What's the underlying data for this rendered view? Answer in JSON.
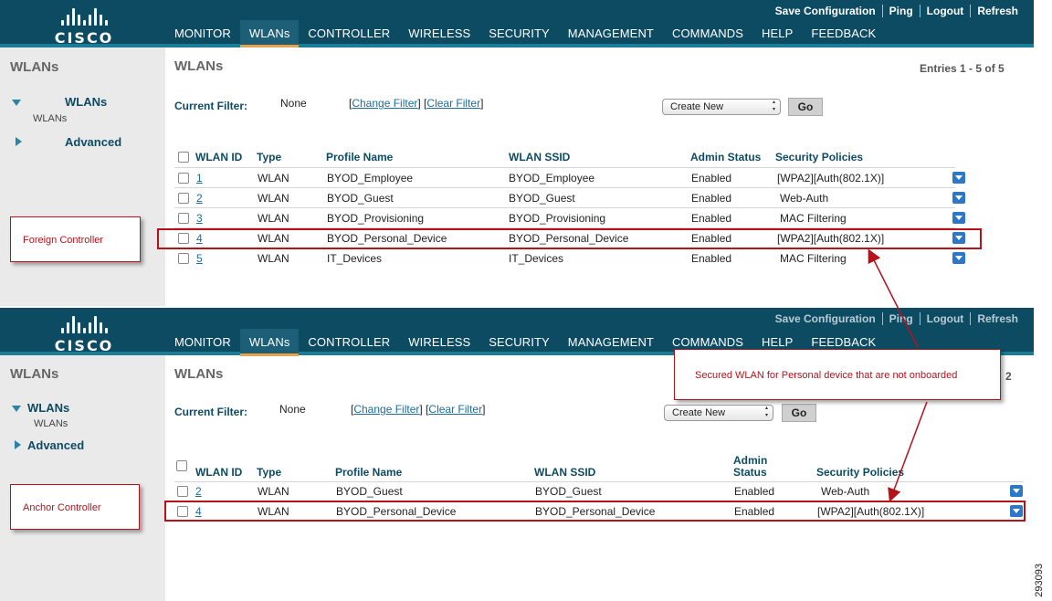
{
  "brand": {
    "name": "CISCO"
  },
  "top_links": [
    "Save Configuration",
    "Ping",
    "Logout",
    "Refresh"
  ],
  "menu": [
    "MONITOR",
    "WLANs",
    "CONTROLLER",
    "WIRELESS",
    "SECURITY",
    "MANAGEMENT",
    "COMMANDS",
    "HELP",
    "FEEDBACK"
  ],
  "active_menu": "WLANs",
  "colors": {
    "header": "#0d4b63",
    "accent": "#e8a24c",
    "callout": "#b5121b",
    "link": "#1d6d9a"
  },
  "foreign": {
    "sidebar": {
      "title": "WLANs",
      "wlans": "WLANs",
      "wlans_sub": "WLANs",
      "advanced": "Advanced"
    },
    "title": "WLANs",
    "entries": "Entries 1 - 5 of 5",
    "filter": {
      "label": "Current Filter:",
      "value": "None",
      "change": "Change Filter",
      "clear": "Clear Filter"
    },
    "create_new": "Create New",
    "go": "Go",
    "columns": [
      "WLAN ID",
      "Type",
      "Profile Name",
      "WLAN SSID",
      "Admin Status",
      "Security Policies"
    ],
    "rows": [
      {
        "id": "1",
        "type": "WLAN",
        "profile": "BYOD_Employee",
        "ssid": "BYOD_Employee",
        "status": "Enabled",
        "security": "[WPA2][Auth(802.1X)]"
      },
      {
        "id": "2",
        "type": "WLAN",
        "profile": "BYOD_Guest",
        "ssid": "BYOD_Guest",
        "status": "Enabled",
        "security": "Web-Auth"
      },
      {
        "id": "3",
        "type": "WLAN",
        "profile": "BYOD_Provisioning",
        "ssid": "BYOD_Provisioning",
        "status": "Enabled",
        "security": "MAC Filtering"
      },
      {
        "id": "4",
        "type": "WLAN",
        "profile": "BYOD_Personal_Device",
        "ssid": "BYOD_Personal_Device",
        "status": "Enabled",
        "security": "[WPA2][Auth(802.1X)]"
      },
      {
        "id": "5",
        "type": "WLAN",
        "profile": "IT_Devices",
        "ssid": "IT_Devices",
        "status": "Enabled",
        "security": "MAC Filtering"
      }
    ]
  },
  "anchor": {
    "sidebar": {
      "title": "WLANs",
      "wlans": "WLANs",
      "wlans_sub": "WLANs",
      "advanced": "Advanced"
    },
    "title": "WLANs",
    "entries_tail": "2",
    "filter": {
      "label": "Current Filter:",
      "value": "None",
      "change": "Change Filter",
      "clear": "Clear Filter"
    },
    "create_new": "Create New",
    "go": "Go",
    "columns": [
      "WLAN ID",
      "Type",
      "Profile Name",
      "WLAN SSID",
      "Admin Status",
      "Security Policies"
    ],
    "admin_status_line1": "Admin",
    "admin_status_line2": "Status",
    "rows": [
      {
        "id": "2",
        "type": "WLAN",
        "profile": "BYOD_Guest",
        "ssid": "BYOD_Guest",
        "status": "Enabled",
        "security": "Web-Auth"
      },
      {
        "id": "4",
        "type": "WLAN",
        "profile": "BYOD_Personal_Device",
        "ssid": "BYOD_Personal_Device",
        "status": "Enabled",
        "security": "[WPA2][Auth(802.1X)]"
      }
    ]
  },
  "annotations": {
    "foreign_label": "Foreign Controller",
    "anchor_label": "Anchor Controller",
    "secured_note": "Secured WLAN for Personal device that are not onboarded"
  },
  "figure_number": "293093"
}
